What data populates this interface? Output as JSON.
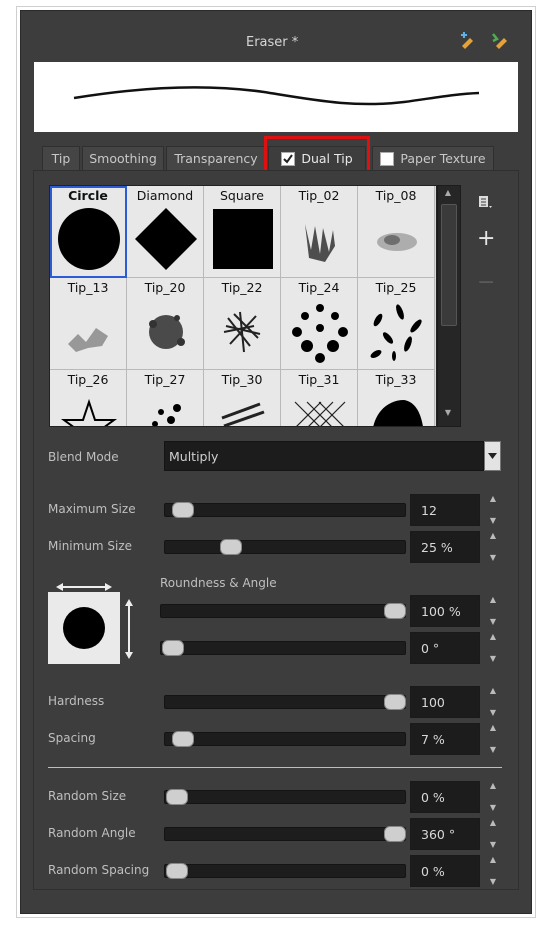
{
  "panel": {
    "title": "Eraser *"
  },
  "tabs": [
    {
      "label": "Tip"
    },
    {
      "label": "Smoothing"
    },
    {
      "label": "Transparency"
    },
    {
      "label": "Dual Tip",
      "checked": true
    },
    {
      "label": "Paper Texture",
      "checked": false
    }
  ],
  "tips": [
    {
      "label": "Circle",
      "selected": true
    },
    {
      "label": "Diamond"
    },
    {
      "label": "Square"
    },
    {
      "label": "Tip_02"
    },
    {
      "label": "Tip_08"
    },
    {
      "label": "Tip_13"
    },
    {
      "label": "Tip_20"
    },
    {
      "label": "Tip_22"
    },
    {
      "label": "Tip_24"
    },
    {
      "label": "Tip_25"
    },
    {
      "label": "Tip_26"
    },
    {
      "label": "Tip_27"
    },
    {
      "label": "Tip_30"
    },
    {
      "label": "Tip_31"
    },
    {
      "label": "Tip_33"
    }
  ],
  "side_buttons": {
    "menu_icon": "menu-icon",
    "add_icon": "+",
    "remove_icon": "−"
  },
  "blend": {
    "label": "Blend Mode",
    "value": "Multiply"
  },
  "size": {
    "max_label": "Maximum Size",
    "max_value": "12",
    "min_label": "Minimum Size",
    "min_value": "25 %"
  },
  "roundness": {
    "label": "Roundness & Angle",
    "roundness_value": "100 %",
    "angle_value": "0 °"
  },
  "hardness": {
    "label": "Hardness",
    "value": "100"
  },
  "spacing": {
    "label": "Spacing",
    "value": "7 %"
  },
  "random": {
    "size_label": "Random Size",
    "size_value": "0 %",
    "angle_label": "Random Angle",
    "angle_value": "360 °",
    "spacing_label": "Random Spacing",
    "spacing_value": "0 %"
  },
  "colors": {
    "highlight": "#e01010",
    "selection": "#2b5bd7"
  }
}
